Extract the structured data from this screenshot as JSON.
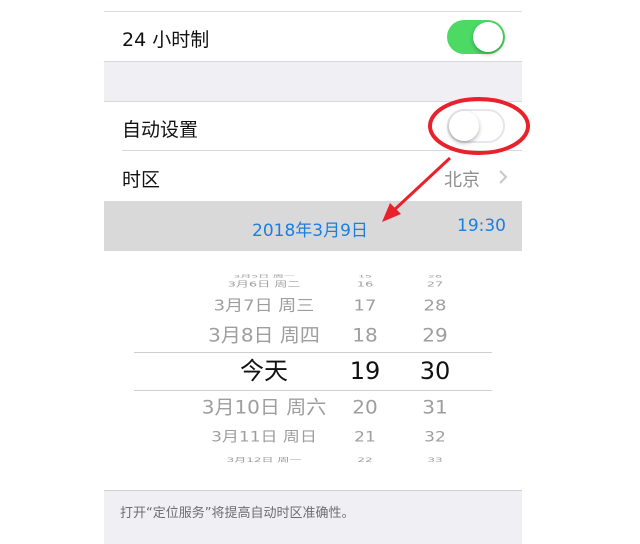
{
  "settings": {
    "hour24_label": "24 小时制",
    "hour24_on": true,
    "auto_label": "自动设置",
    "auto_on": false,
    "timezone_label": "时区",
    "timezone_value": "北京"
  },
  "header_bar": {
    "date": "2018年3月9日",
    "time": "19:30"
  },
  "picker": {
    "dates": [
      "3月5日 周一",
      "3月6日 周二",
      "3月7日 周三",
      "3月8日 周四",
      "今天",
      "3月10日 周六",
      "3月11日 周日",
      "3月12日 周一"
    ],
    "hours": [
      "15",
      "16",
      "17",
      "18",
      "19",
      "20",
      "21",
      "22"
    ],
    "minutes": [
      "26",
      "27",
      "28",
      "29",
      "30",
      "31",
      "32",
      "33"
    ],
    "selected_index": 4
  },
  "footer": {
    "note": "打开“定位服务”将提高自动时区准确性。"
  },
  "colors": {
    "accent_blue": "#1a7fe0",
    "toggle_green": "#4cd964",
    "annotation_red": "#e8212b"
  }
}
